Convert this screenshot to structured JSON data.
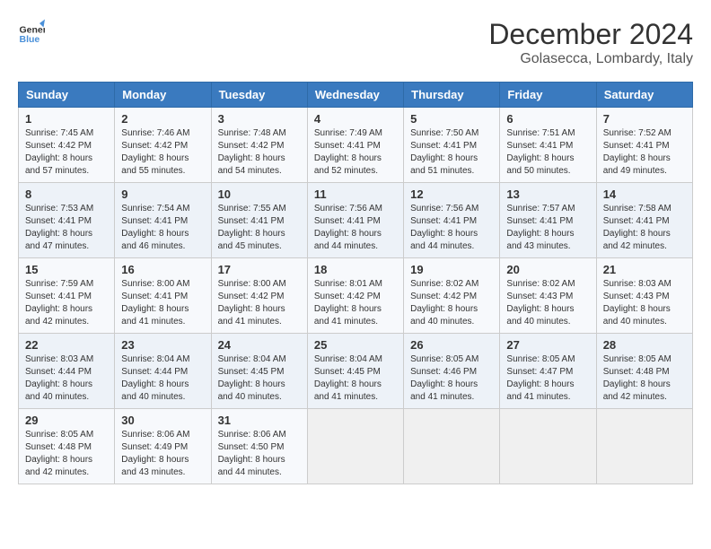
{
  "header": {
    "logo_line1": "General",
    "logo_line2": "Blue",
    "month_title": "December 2024",
    "location": "Golasecca, Lombardy, Italy"
  },
  "weekdays": [
    "Sunday",
    "Monday",
    "Tuesday",
    "Wednesday",
    "Thursday",
    "Friday",
    "Saturday"
  ],
  "weeks": [
    [
      {
        "day": "1",
        "sunrise": "7:45 AM",
        "sunset": "4:42 PM",
        "daylight": "8 hours and 57 minutes."
      },
      {
        "day": "2",
        "sunrise": "7:46 AM",
        "sunset": "4:42 PM",
        "daylight": "8 hours and 55 minutes."
      },
      {
        "day": "3",
        "sunrise": "7:48 AM",
        "sunset": "4:42 PM",
        "daylight": "8 hours and 54 minutes."
      },
      {
        "day": "4",
        "sunrise": "7:49 AM",
        "sunset": "4:41 PM",
        "daylight": "8 hours and 52 minutes."
      },
      {
        "day": "5",
        "sunrise": "7:50 AM",
        "sunset": "4:41 PM",
        "daylight": "8 hours and 51 minutes."
      },
      {
        "day": "6",
        "sunrise": "7:51 AM",
        "sunset": "4:41 PM",
        "daylight": "8 hours and 50 minutes."
      },
      {
        "day": "7",
        "sunrise": "7:52 AM",
        "sunset": "4:41 PM",
        "daylight": "8 hours and 49 minutes."
      }
    ],
    [
      {
        "day": "8",
        "sunrise": "7:53 AM",
        "sunset": "4:41 PM",
        "daylight": "8 hours and 47 minutes."
      },
      {
        "day": "9",
        "sunrise": "7:54 AM",
        "sunset": "4:41 PM",
        "daylight": "8 hours and 46 minutes."
      },
      {
        "day": "10",
        "sunrise": "7:55 AM",
        "sunset": "4:41 PM",
        "daylight": "8 hours and 45 minutes."
      },
      {
        "day": "11",
        "sunrise": "7:56 AM",
        "sunset": "4:41 PM",
        "daylight": "8 hours and 44 minutes."
      },
      {
        "day": "12",
        "sunrise": "7:56 AM",
        "sunset": "4:41 PM",
        "daylight": "8 hours and 44 minutes."
      },
      {
        "day": "13",
        "sunrise": "7:57 AM",
        "sunset": "4:41 PM",
        "daylight": "8 hours and 43 minutes."
      },
      {
        "day": "14",
        "sunrise": "7:58 AM",
        "sunset": "4:41 PM",
        "daylight": "8 hours and 42 minutes."
      }
    ],
    [
      {
        "day": "15",
        "sunrise": "7:59 AM",
        "sunset": "4:41 PM",
        "daylight": "8 hours and 42 minutes."
      },
      {
        "day": "16",
        "sunrise": "8:00 AM",
        "sunset": "4:41 PM",
        "daylight": "8 hours and 41 minutes."
      },
      {
        "day": "17",
        "sunrise": "8:00 AM",
        "sunset": "4:42 PM",
        "daylight": "8 hours and 41 minutes."
      },
      {
        "day": "18",
        "sunrise": "8:01 AM",
        "sunset": "4:42 PM",
        "daylight": "8 hours and 41 minutes."
      },
      {
        "day": "19",
        "sunrise": "8:02 AM",
        "sunset": "4:42 PM",
        "daylight": "8 hours and 40 minutes."
      },
      {
        "day": "20",
        "sunrise": "8:02 AM",
        "sunset": "4:43 PM",
        "daylight": "8 hours and 40 minutes."
      },
      {
        "day": "21",
        "sunrise": "8:03 AM",
        "sunset": "4:43 PM",
        "daylight": "8 hours and 40 minutes."
      }
    ],
    [
      {
        "day": "22",
        "sunrise": "8:03 AM",
        "sunset": "4:44 PM",
        "daylight": "8 hours and 40 minutes."
      },
      {
        "day": "23",
        "sunrise": "8:04 AM",
        "sunset": "4:44 PM",
        "daylight": "8 hours and 40 minutes."
      },
      {
        "day": "24",
        "sunrise": "8:04 AM",
        "sunset": "4:45 PM",
        "daylight": "8 hours and 40 minutes."
      },
      {
        "day": "25",
        "sunrise": "8:04 AM",
        "sunset": "4:45 PM",
        "daylight": "8 hours and 41 minutes."
      },
      {
        "day": "26",
        "sunrise": "8:05 AM",
        "sunset": "4:46 PM",
        "daylight": "8 hours and 41 minutes."
      },
      {
        "day": "27",
        "sunrise": "8:05 AM",
        "sunset": "4:47 PM",
        "daylight": "8 hours and 41 minutes."
      },
      {
        "day": "28",
        "sunrise": "8:05 AM",
        "sunset": "4:48 PM",
        "daylight": "8 hours and 42 minutes."
      }
    ],
    [
      {
        "day": "29",
        "sunrise": "8:05 AM",
        "sunset": "4:48 PM",
        "daylight": "8 hours and 42 minutes."
      },
      {
        "day": "30",
        "sunrise": "8:06 AM",
        "sunset": "4:49 PM",
        "daylight": "8 hours and 43 minutes."
      },
      {
        "day": "31",
        "sunrise": "8:06 AM",
        "sunset": "4:50 PM",
        "daylight": "8 hours and 44 minutes."
      },
      null,
      null,
      null,
      null
    ]
  ]
}
